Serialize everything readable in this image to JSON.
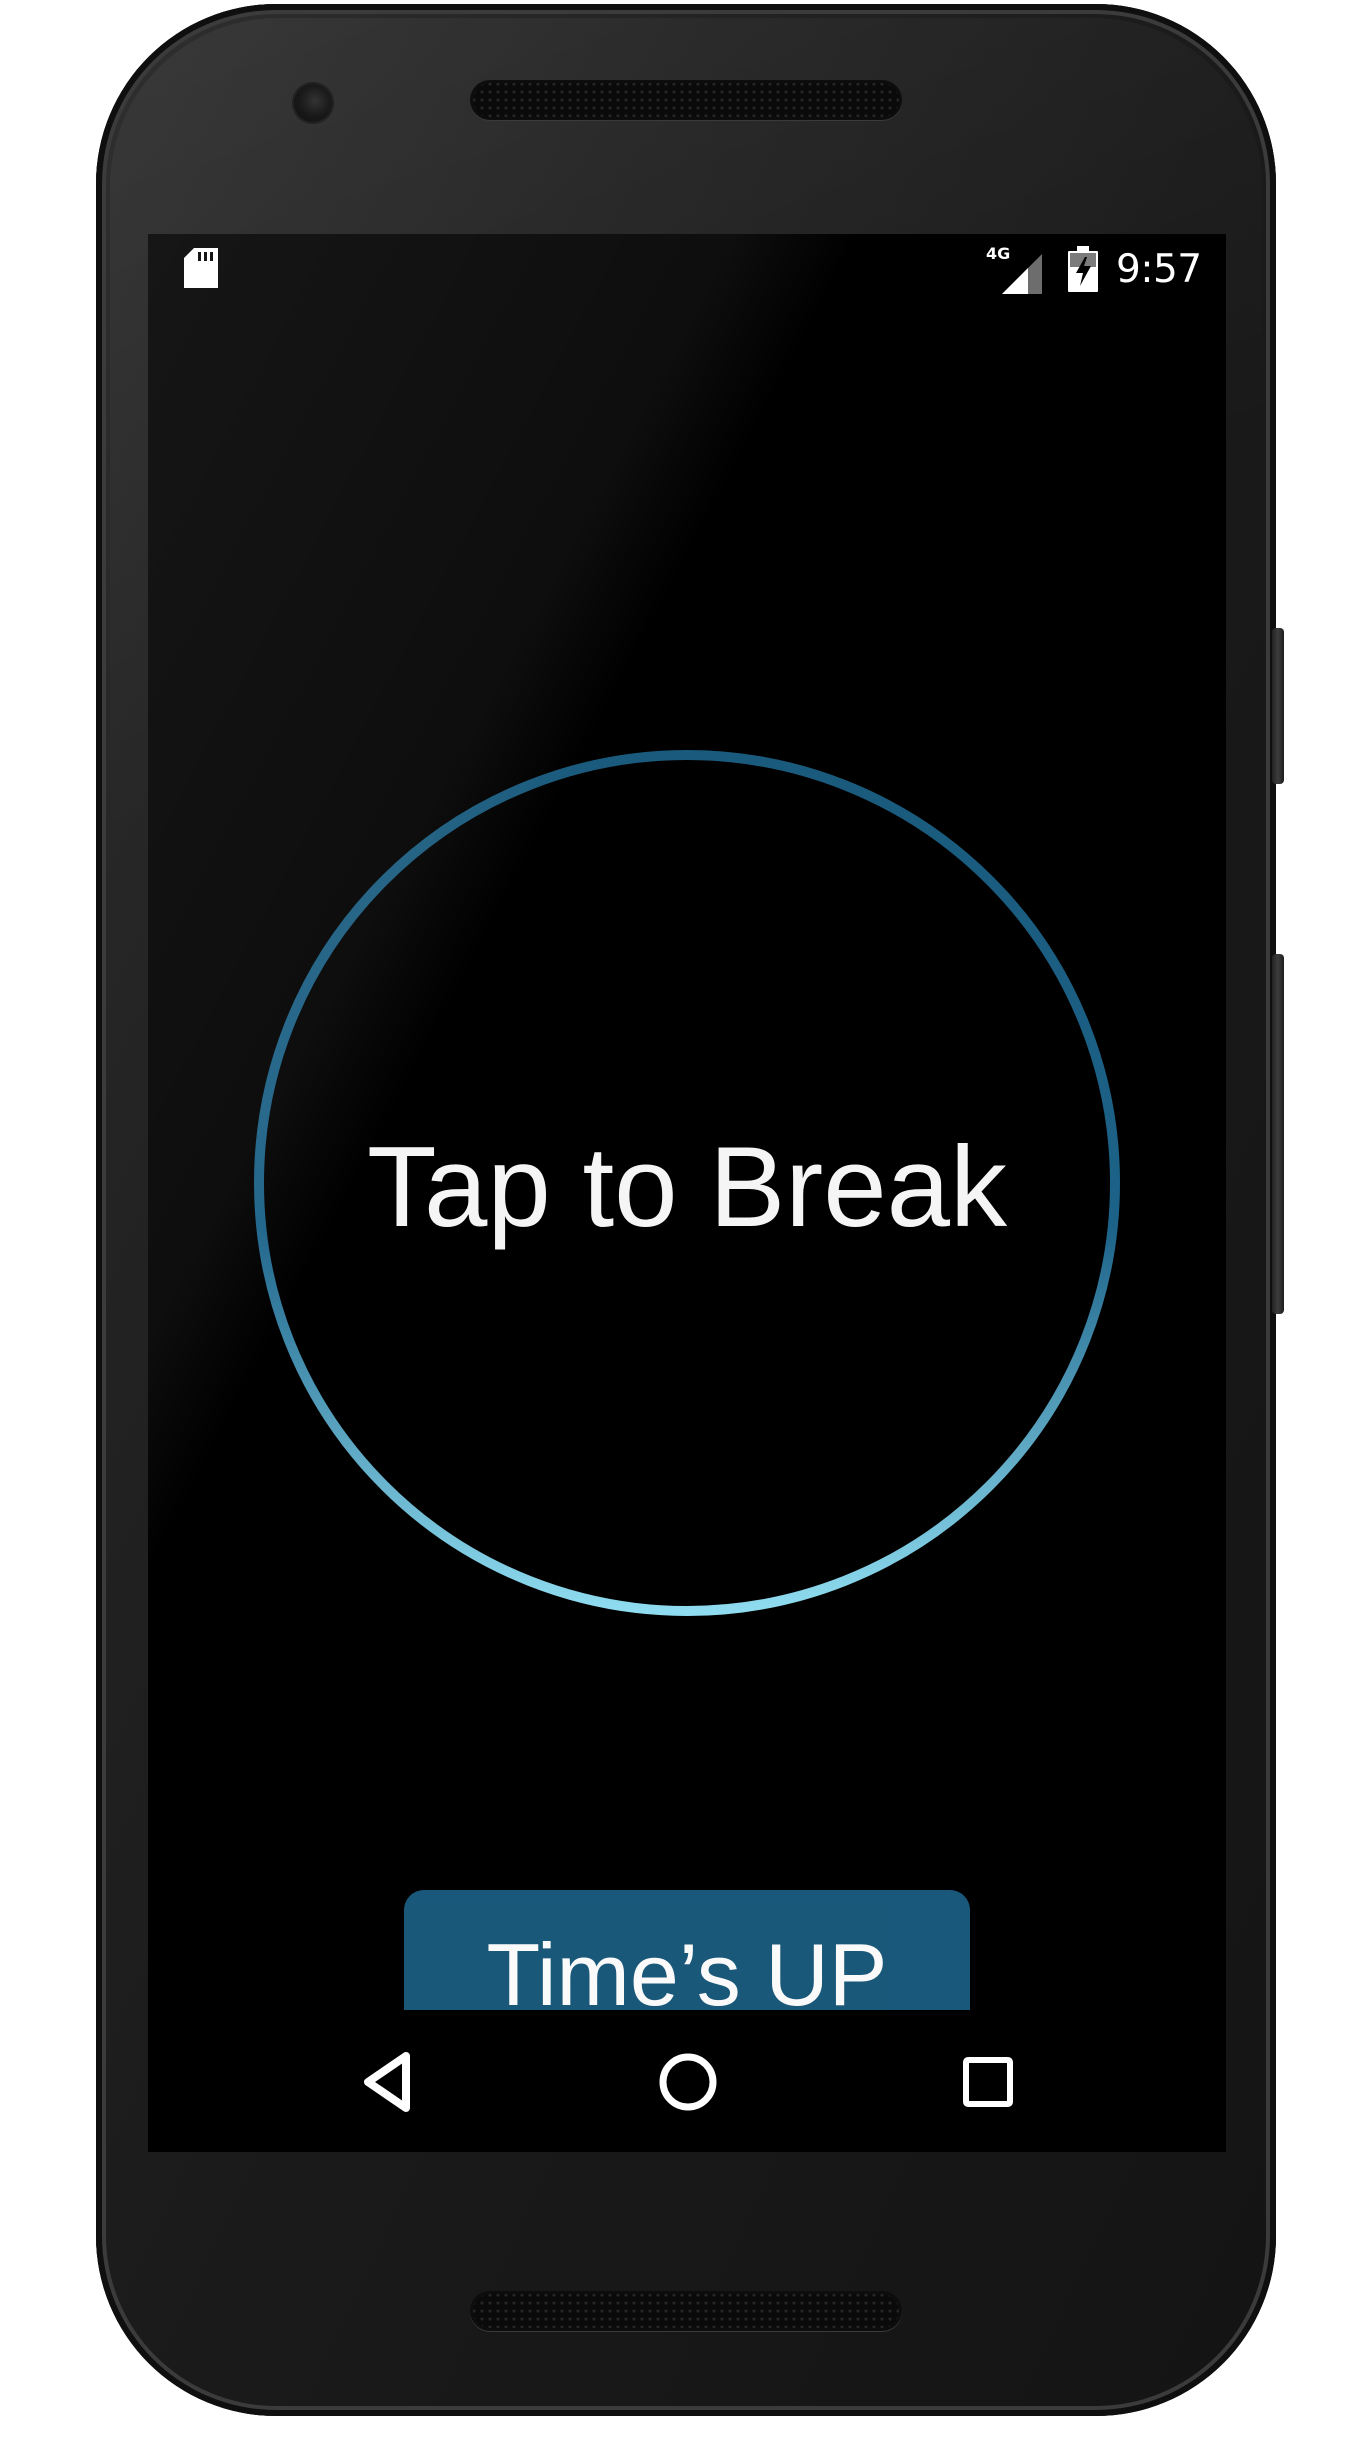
{
  "device": {
    "body_color": "#1a1a1a",
    "screen_color": "#000000"
  },
  "status_bar": {
    "icons": {
      "left": "sd-card-icon",
      "signal": "cell-signal-icon",
      "battery": "battery-charging-icon"
    },
    "network_label": "4G",
    "time": "9:57"
  },
  "timer": {
    "label": "Tap to Break",
    "ring_colors": {
      "top": "#1a5a7c",
      "bottom": "#8fdcf0"
    }
  },
  "action": {
    "label": "Time’s UP",
    "color": "#1a5a7c"
  },
  "navigation": {
    "back_icon": "back-triangle-icon",
    "home_icon": "home-circle-icon",
    "recents_icon": "recents-square-icon"
  }
}
